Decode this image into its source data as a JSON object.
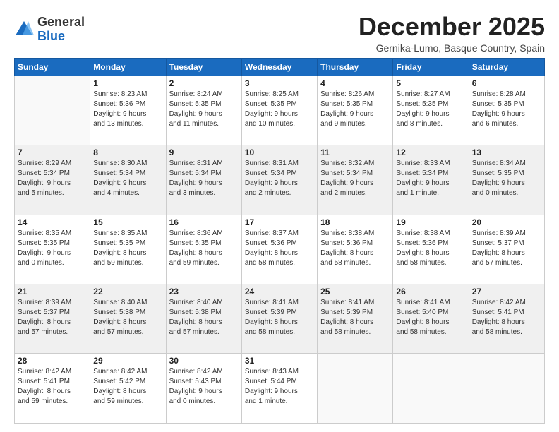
{
  "header": {
    "logo_general": "General",
    "logo_blue": "Blue",
    "month_title": "December 2025",
    "location": "Gernika-Lumo, Basque Country, Spain"
  },
  "days_of_week": [
    "Sunday",
    "Monday",
    "Tuesday",
    "Wednesday",
    "Thursday",
    "Friday",
    "Saturday"
  ],
  "weeks": [
    [
      {
        "day": "",
        "info": ""
      },
      {
        "day": "1",
        "info": "Sunrise: 8:23 AM\nSunset: 5:36 PM\nDaylight: 9 hours\nand 13 minutes."
      },
      {
        "day": "2",
        "info": "Sunrise: 8:24 AM\nSunset: 5:35 PM\nDaylight: 9 hours\nand 11 minutes."
      },
      {
        "day": "3",
        "info": "Sunrise: 8:25 AM\nSunset: 5:35 PM\nDaylight: 9 hours\nand 10 minutes."
      },
      {
        "day": "4",
        "info": "Sunrise: 8:26 AM\nSunset: 5:35 PM\nDaylight: 9 hours\nand 9 minutes."
      },
      {
        "day": "5",
        "info": "Sunrise: 8:27 AM\nSunset: 5:35 PM\nDaylight: 9 hours\nand 8 minutes."
      },
      {
        "day": "6",
        "info": "Sunrise: 8:28 AM\nSunset: 5:35 PM\nDaylight: 9 hours\nand 6 minutes."
      }
    ],
    [
      {
        "day": "7",
        "info": "Sunrise: 8:29 AM\nSunset: 5:34 PM\nDaylight: 9 hours\nand 5 minutes."
      },
      {
        "day": "8",
        "info": "Sunrise: 8:30 AM\nSunset: 5:34 PM\nDaylight: 9 hours\nand 4 minutes."
      },
      {
        "day": "9",
        "info": "Sunrise: 8:31 AM\nSunset: 5:34 PM\nDaylight: 9 hours\nand 3 minutes."
      },
      {
        "day": "10",
        "info": "Sunrise: 8:31 AM\nSunset: 5:34 PM\nDaylight: 9 hours\nand 2 minutes."
      },
      {
        "day": "11",
        "info": "Sunrise: 8:32 AM\nSunset: 5:34 PM\nDaylight: 9 hours\nand 2 minutes."
      },
      {
        "day": "12",
        "info": "Sunrise: 8:33 AM\nSunset: 5:34 PM\nDaylight: 9 hours\nand 1 minute."
      },
      {
        "day": "13",
        "info": "Sunrise: 8:34 AM\nSunset: 5:35 PM\nDaylight: 9 hours\nand 0 minutes."
      }
    ],
    [
      {
        "day": "14",
        "info": "Sunrise: 8:35 AM\nSunset: 5:35 PM\nDaylight: 9 hours\nand 0 minutes."
      },
      {
        "day": "15",
        "info": "Sunrise: 8:35 AM\nSunset: 5:35 PM\nDaylight: 8 hours\nand 59 minutes."
      },
      {
        "day": "16",
        "info": "Sunrise: 8:36 AM\nSunset: 5:35 PM\nDaylight: 8 hours\nand 59 minutes."
      },
      {
        "day": "17",
        "info": "Sunrise: 8:37 AM\nSunset: 5:36 PM\nDaylight: 8 hours\nand 58 minutes."
      },
      {
        "day": "18",
        "info": "Sunrise: 8:38 AM\nSunset: 5:36 PM\nDaylight: 8 hours\nand 58 minutes."
      },
      {
        "day": "19",
        "info": "Sunrise: 8:38 AM\nSunset: 5:36 PM\nDaylight: 8 hours\nand 58 minutes."
      },
      {
        "day": "20",
        "info": "Sunrise: 8:39 AM\nSunset: 5:37 PM\nDaylight: 8 hours\nand 57 minutes."
      }
    ],
    [
      {
        "day": "21",
        "info": "Sunrise: 8:39 AM\nSunset: 5:37 PM\nDaylight: 8 hours\nand 57 minutes."
      },
      {
        "day": "22",
        "info": "Sunrise: 8:40 AM\nSunset: 5:38 PM\nDaylight: 8 hours\nand 57 minutes."
      },
      {
        "day": "23",
        "info": "Sunrise: 8:40 AM\nSunset: 5:38 PM\nDaylight: 8 hours\nand 57 minutes."
      },
      {
        "day": "24",
        "info": "Sunrise: 8:41 AM\nSunset: 5:39 PM\nDaylight: 8 hours\nand 58 minutes."
      },
      {
        "day": "25",
        "info": "Sunrise: 8:41 AM\nSunset: 5:39 PM\nDaylight: 8 hours\nand 58 minutes."
      },
      {
        "day": "26",
        "info": "Sunrise: 8:41 AM\nSunset: 5:40 PM\nDaylight: 8 hours\nand 58 minutes."
      },
      {
        "day": "27",
        "info": "Sunrise: 8:42 AM\nSunset: 5:41 PM\nDaylight: 8 hours\nand 58 minutes."
      }
    ],
    [
      {
        "day": "28",
        "info": "Sunrise: 8:42 AM\nSunset: 5:41 PM\nDaylight: 8 hours\nand 59 minutes."
      },
      {
        "day": "29",
        "info": "Sunrise: 8:42 AM\nSunset: 5:42 PM\nDaylight: 8 hours\nand 59 minutes."
      },
      {
        "day": "30",
        "info": "Sunrise: 8:42 AM\nSunset: 5:43 PM\nDaylight: 9 hours\nand 0 minutes."
      },
      {
        "day": "31",
        "info": "Sunrise: 8:43 AM\nSunset: 5:44 PM\nDaylight: 9 hours\nand 1 minute."
      },
      {
        "day": "",
        "info": ""
      },
      {
        "day": "",
        "info": ""
      },
      {
        "day": "",
        "info": ""
      }
    ]
  ]
}
